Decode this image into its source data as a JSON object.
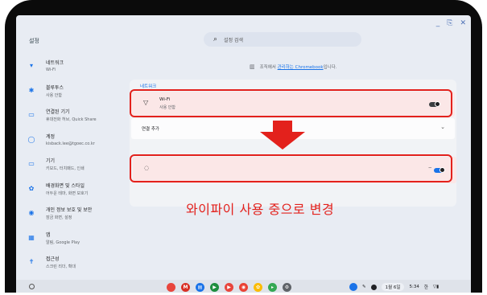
{
  "window": {
    "title": "설정",
    "controls": [
      "_",
      "⎘",
      "✕"
    ]
  },
  "search": {
    "placeholder": "설정 검색"
  },
  "sidebar": {
    "items": [
      {
        "icon": "wifi-icon",
        "glyph": "▾",
        "label": "네트워크",
        "sub": "Wi-Fi"
      },
      {
        "icon": "bluetooth-icon",
        "glyph": "✱",
        "label": "블루투스",
        "sub": "사용 안함"
      },
      {
        "icon": "connected-devices-icon",
        "glyph": "▭",
        "label": "연결된 기기",
        "sub": "휴대전화 허브, Quick Share"
      },
      {
        "icon": "account-icon",
        "glyph": "◯",
        "label": "계정",
        "sub": "kisback.lee@tgoec.co.kr"
      },
      {
        "icon": "device-icon",
        "glyph": "▭",
        "label": "기기",
        "sub": "키보드, 터치패드, 인쇄"
      },
      {
        "icon": "personalization-icon",
        "glyph": "✿",
        "label": "배경화면 및 스타일",
        "sub": "어두운 테마, 화면 보호기"
      },
      {
        "icon": "privacy-icon",
        "glyph": "◉",
        "label": "개인 정보 보호 및 보안",
        "sub": "잠금 화면, 설정"
      },
      {
        "icon": "apps-icon",
        "glyph": "▦",
        "label": "앱",
        "sub": "알림, Google Play"
      },
      {
        "icon": "accessibility-icon",
        "glyph": "✝",
        "label": "접근성",
        "sub": "스크린 리더, 확대"
      },
      {
        "icon": "system-icon",
        "glyph": "",
        "label": "시스템 환경설정",
        "sub": ""
      }
    ]
  },
  "managed": {
    "prefix": "조직에서 ",
    "link": "관리하는 Chromebook",
    "suffix": "입니다."
  },
  "network": {
    "section_title": "네트워크",
    "wifi_label": "Wi-Fi",
    "wifi_status": "사용 안함",
    "add_connection": "연결 추가",
    "after_status_label": "사용 중"
  },
  "annotation": {
    "text": "와이파이 사용 중으로 변경",
    "color": "#e3211c"
  },
  "shelf": {
    "apps": [
      {
        "name": "chrome",
        "color": "#e8453c",
        "glyph": ""
      },
      {
        "name": "gmail",
        "color": "#d93025",
        "glyph": "M"
      },
      {
        "name": "docs",
        "color": "#1a73e8",
        "glyph": "▤"
      },
      {
        "name": "meet",
        "color": "#1e8e3e",
        "glyph": "▶"
      },
      {
        "name": "youtube",
        "color": "#e8453c",
        "glyph": "▶"
      },
      {
        "name": "youtube-music",
        "color": "#ea4335",
        "glyph": "◉"
      },
      {
        "name": "photos",
        "color": "#fbbc04",
        "glyph": "✿"
      },
      {
        "name": "play-store",
        "color": "#34a853",
        "glyph": "▸"
      },
      {
        "name": "settings",
        "color": "#5f6368",
        "glyph": "⚙"
      }
    ],
    "date": "1월 6일",
    "time": "5:34",
    "ime": "한"
  }
}
